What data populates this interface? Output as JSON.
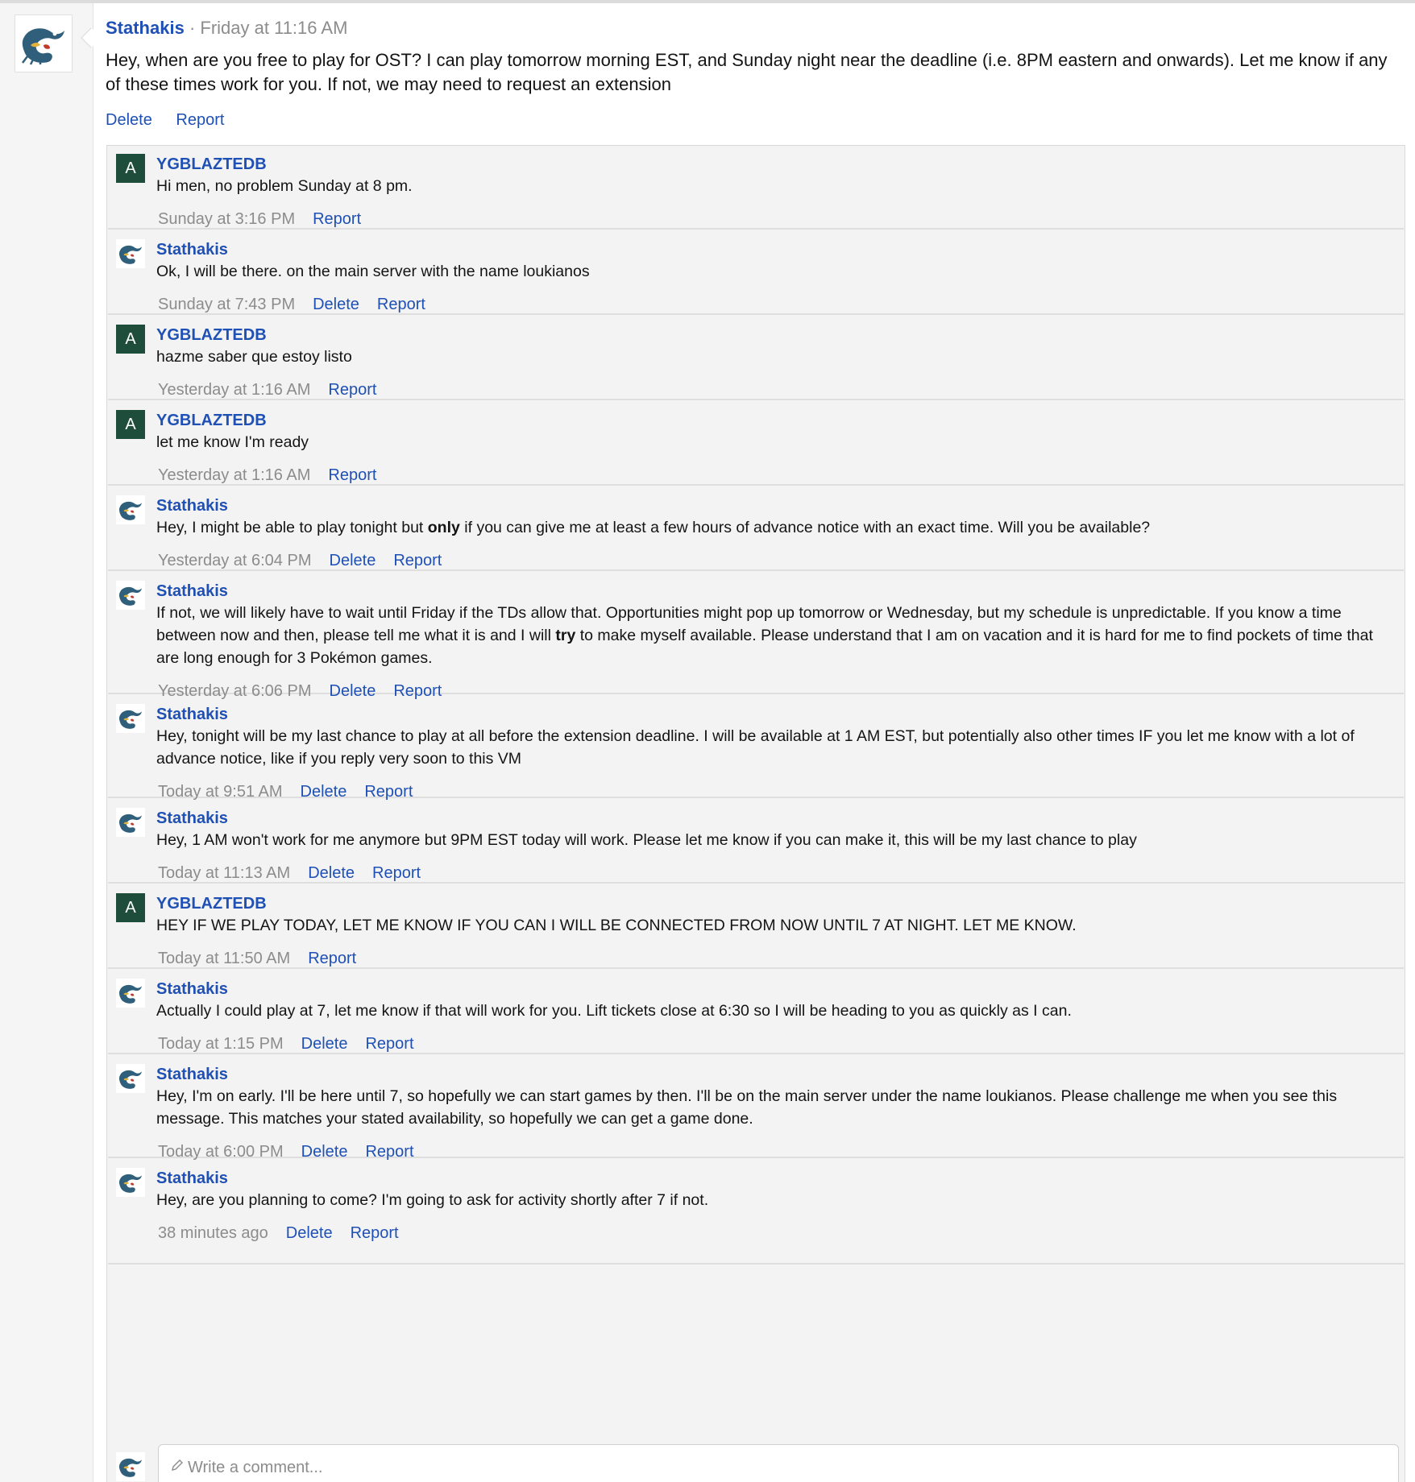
{
  "post": {
    "author": "Stathakis",
    "separator": " · ",
    "time": "Friday at 11:16 AM",
    "text": "Hey, when are you free to play for OST? I can play tomorrow morning EST, and Sunday night near the deadline (i.e. 8PM eastern and onwards). Let me know if any of these times work for you. If not, we may need to request an extension",
    "actions": [
      "Delete",
      "Report"
    ]
  },
  "labels": {
    "delete": "Delete",
    "report": "Report",
    "avatar_letter": "A"
  },
  "comments": [
    {
      "author": "YGBLAZTEDB",
      "avatar": "letter",
      "parts": [
        {
          "t": "Hi men, no problem Sunday at 8 pm."
        }
      ],
      "time": "Sunday at 3:16 PM",
      "can_delete": false
    },
    {
      "author": "Stathakis",
      "avatar": "image",
      "parts": [
        {
          "t": "Ok, I will be there. on the main server with the name loukianos"
        }
      ],
      "time": "Sunday at 7:43 PM",
      "can_delete": true
    },
    {
      "author": "YGBLAZTEDB",
      "avatar": "letter",
      "parts": [
        {
          "t": "hazme saber que estoy listo"
        }
      ],
      "time": "Yesterday at 1:16 AM",
      "can_delete": false
    },
    {
      "author": "YGBLAZTEDB",
      "avatar": "letter",
      "parts": [
        {
          "t": "let me know I'm ready"
        }
      ],
      "time": "Yesterday at 1:16 AM",
      "can_delete": false
    },
    {
      "author": "Stathakis",
      "avatar": "image",
      "parts": [
        {
          "t": "Hey, I might be able to play tonight but "
        },
        {
          "t": "only",
          "b": true
        },
        {
          "t": " if you can give me at least a few hours of advance notice with an exact time. Will you be available?"
        }
      ],
      "time": "Yesterday at 6:04 PM",
      "can_delete": true
    },
    {
      "author": "Stathakis",
      "avatar": "image",
      "parts": [
        {
          "t": "If not, we will likely have to wait until Friday if the TDs allow that. Opportunities might pop up tomorrow or Wednesday, but my schedule is unpredictable. If you know a time between now and then, please tell me what it is and I will "
        },
        {
          "t": "try",
          "b": true
        },
        {
          "t": " to make myself available. Please understand that I am on vacation and it is hard for me to find pockets of time that are long enough for 3 Pokémon games."
        }
      ],
      "time": "Yesterday at 6:06 PM",
      "can_delete": true
    },
    {
      "author": "Stathakis",
      "avatar": "image",
      "parts": [
        {
          "t": "Hey, tonight will be my last chance to play at all before the extension deadline. I will be available at 1 AM EST, but potentially also other times IF you let me know with a lot of advance notice, like if you reply very soon to this VM"
        }
      ],
      "time": "Today at 9:51 AM",
      "can_delete": true
    },
    {
      "author": "Stathakis",
      "avatar": "image",
      "parts": [
        {
          "t": "Hey, 1 AM won't work for me anymore but 9PM EST today will work. Please let me know if you can make it, this will be my last chance to play"
        }
      ],
      "time": "Today at 11:13 AM",
      "can_delete": true
    },
    {
      "author": "YGBLAZTEDB",
      "avatar": "letter",
      "parts": [
        {
          "t": "HEY IF WE PLAY TODAY, LET ME KNOW IF YOU CAN I WILL BE CONNECTED FROM NOW UNTIL 7 AT NIGHT. LET ME KNOW."
        }
      ],
      "time": "Today at 11:50 AM",
      "can_delete": false
    },
    {
      "author": "Stathakis",
      "avatar": "image",
      "parts": [
        {
          "t": "Actually I could play at 7, let me know if that will work for you. Lift tickets close at 6:30 so I will be heading to you as quickly as I can."
        }
      ],
      "time": "Today at 1:15 PM",
      "can_delete": true
    },
    {
      "author": "Stathakis",
      "avatar": "image",
      "parts": [
        {
          "t": "Hey, I'm on early. I'll be here until 7, so hopefully we can start games by then. I'll be on the main server under the name loukianos. Please challenge me when you see this message. This matches your stated availability, so hopefully we can get a game done."
        }
      ],
      "time": "Today at 6:00 PM",
      "can_delete": true
    },
    {
      "author": "Stathakis",
      "avatar": "image",
      "parts": [
        {
          "t": "Hey, are you planning to come? I'm going to ask for activity shortly after 7 if not."
        }
      ],
      "time": "38 minutes ago",
      "can_delete": true
    }
  ],
  "reply": {
    "placeholder": "Write a comment..."
  },
  "colors": {
    "link": "#1f50b5",
    "muted": "#8c8c8c",
    "avatar_bg": "#1e4d3c"
  }
}
